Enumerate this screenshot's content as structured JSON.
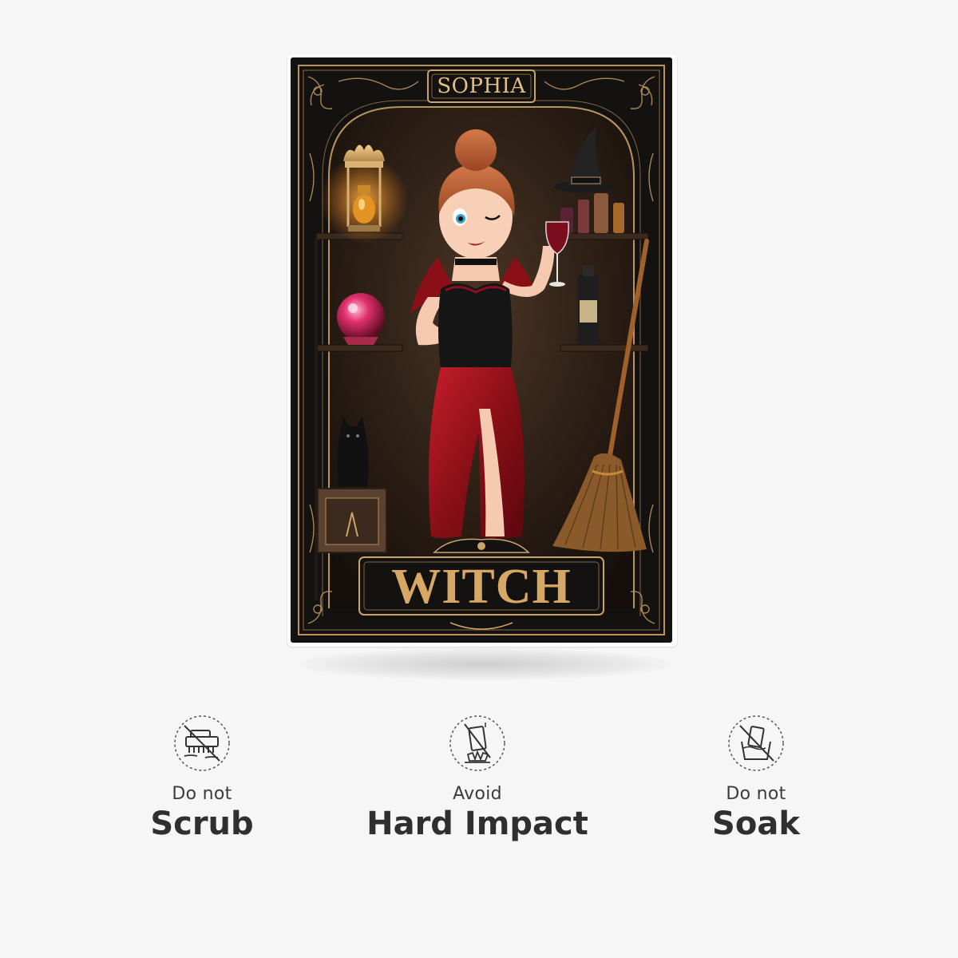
{
  "card": {
    "name": "SOPHIA",
    "title": "WITCH"
  },
  "care": [
    {
      "sub": "Do not",
      "main": "Scrub",
      "icon": "no-scrub-icon"
    },
    {
      "sub": "Avoid",
      "main": "Hard Impact",
      "icon": "no-impact-icon"
    },
    {
      "sub": "Do not",
      "main": "Soak",
      "icon": "no-soak-icon"
    }
  ],
  "colors": {
    "background": "#f6f6f6",
    "card": "#141210",
    "gold": "#c9a36a",
    "text": "#2f2f2f"
  }
}
